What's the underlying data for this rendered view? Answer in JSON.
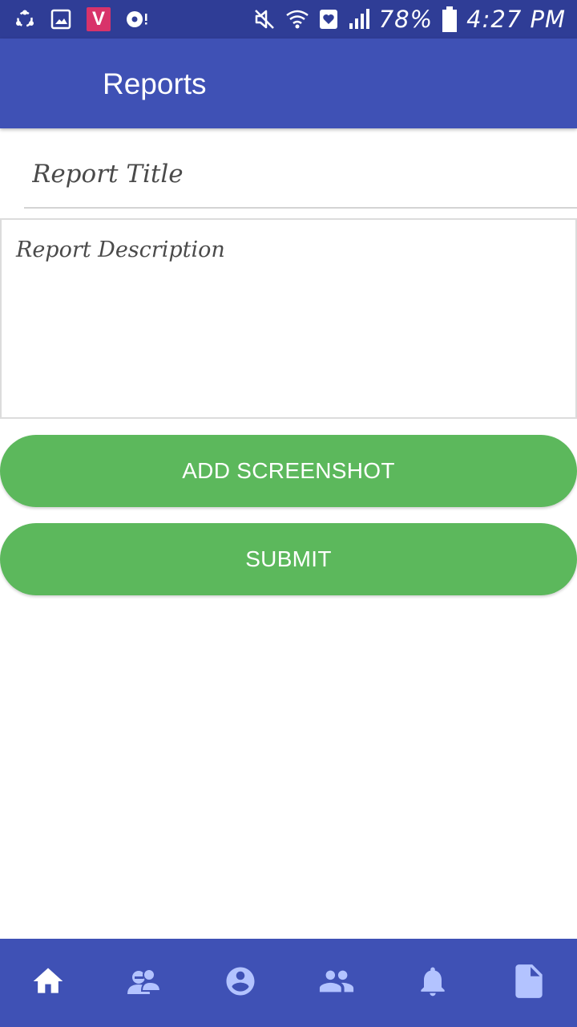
{
  "status_bar": {
    "battery_percent": "78%",
    "time": "4:27 PM",
    "badge_letter": "V",
    "left_icons": [
      "share-icon",
      "gallery-icon",
      "vidmate-icon",
      "media-record-icon"
    ],
    "right_icons": [
      "mute-icon",
      "wifi-icon",
      "heart-box-icon",
      "signal-icon",
      "battery-icon"
    ],
    "background_color": "#2f3d96"
  },
  "app_bar": {
    "title": "Reports",
    "background_color": "#3f51b5"
  },
  "form": {
    "title_placeholder": "Report Title",
    "title_value": "",
    "description_placeholder": "Report Description",
    "description_value": ""
  },
  "buttons": {
    "add_screenshot_label": "ADD SCREENSHOT",
    "submit_label": "SUBMIT",
    "color": "#5cb85c"
  },
  "bottom_nav": {
    "items": [
      {
        "icon": "home-icon",
        "active": true
      },
      {
        "icon": "chat-people-icon",
        "active": false
      },
      {
        "icon": "profile-icon",
        "active": false
      },
      {
        "icon": "group-icon",
        "active": false
      },
      {
        "icon": "bell-icon",
        "active": false
      },
      {
        "icon": "document-icon",
        "active": false
      }
    ],
    "active_color": "#ffffff",
    "inactive_color": "#b3c3ff",
    "background_color": "#3f51b5"
  }
}
